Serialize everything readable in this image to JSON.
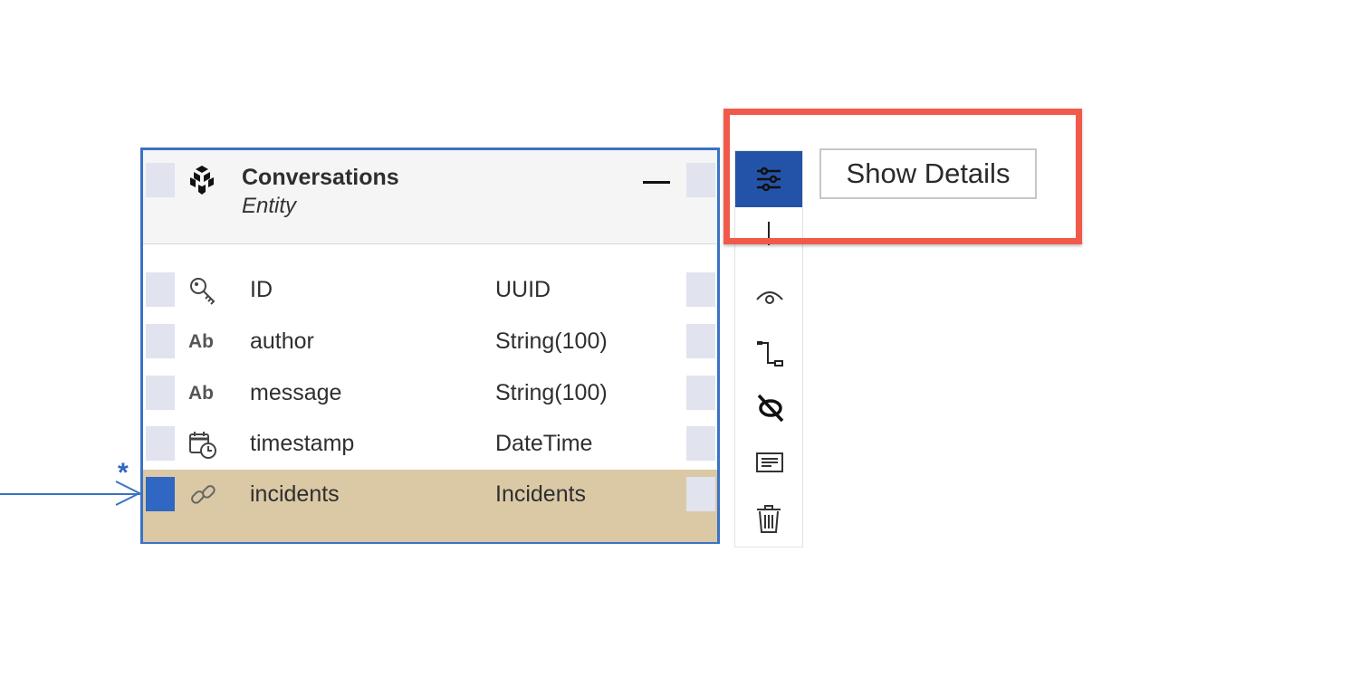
{
  "entity": {
    "title": "Conversations",
    "subtitle": "Entity",
    "icon": "entity-cube-icon",
    "fields": [
      {
        "name": "ID",
        "type": "UUID",
        "icon": "key-icon"
      },
      {
        "name": "author",
        "type": "String(100)",
        "icon": "text-type-icon",
        "icon_text": "Ab"
      },
      {
        "name": "message",
        "type": "String(100)",
        "icon": "text-type-icon",
        "icon_text": "Ab"
      },
      {
        "name": "timestamp",
        "type": "DateTime",
        "icon": "calendar-clock-icon"
      },
      {
        "name": "incidents",
        "type": "Incidents",
        "icon": "link-icon",
        "selected": true
      }
    ]
  },
  "relationship": {
    "multiplicity": "*"
  },
  "toolbar": {
    "items": [
      {
        "name": "show-details",
        "icon": "sliders-icon",
        "active": true
      },
      {
        "name": "toggle-visibility",
        "icon": "eye-icon"
      },
      {
        "name": "connect",
        "icon": "connector-icon"
      },
      {
        "name": "remove-link",
        "icon": "unlink-icon"
      },
      {
        "name": "notes",
        "icon": "note-icon"
      },
      {
        "name": "delete",
        "icon": "trash-icon"
      }
    ]
  },
  "tooltip": {
    "label": "Show Details"
  },
  "colors": {
    "entity_border": "#3a72c4",
    "selected_row": "#dbc9a6",
    "toolbar_active": "#2353a9",
    "highlight": "#f15a4a"
  }
}
